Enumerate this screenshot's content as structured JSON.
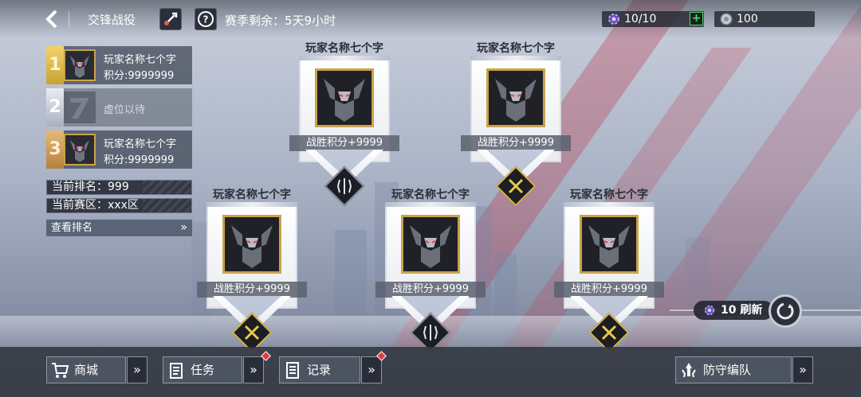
{
  "header": {
    "title": "交锋战役",
    "season_remaining": "赛季剩余：5天9小时"
  },
  "resources": {
    "energy": "10/10",
    "currency": "100",
    "plus_label": "+"
  },
  "ranking": {
    "items": [
      {
        "rank": "1",
        "name": "玩家名称七个字",
        "score": "积分:9999999"
      },
      {
        "rank": "2",
        "name": "",
        "score": "",
        "empty_label": "虚位以待"
      },
      {
        "rank": "3",
        "name": "玩家名称七个字",
        "score": "积分:9999999"
      }
    ],
    "current_rank": "当前排名：999",
    "current_zone": "当前赛区：xxx区",
    "view_rank": "查看排名",
    "view_rank_chevron": "»"
  },
  "opponents": [
    {
      "name": "玩家名称七个字",
      "reward": "战胜积分+9999",
      "badge": "shield-badge"
    },
    {
      "name": "玩家名称七个字",
      "reward": "战胜积分+9999",
      "badge": "swords-badge"
    },
    {
      "name": "玩家名称七个字",
      "reward": "战胜积分+9999",
      "badge": "swords-badge"
    },
    {
      "name": "玩家名称七个字",
      "reward": "战胜积分+9999",
      "badge": "shield-badge"
    },
    {
      "name": "玩家名称七个字",
      "reward": "战胜积分+9999",
      "badge": "swords-badge"
    }
  ],
  "refresh": {
    "label": "10 刷新"
  },
  "bottom_nav": {
    "shop": "商城",
    "tasks": "任务",
    "records": "记录",
    "defense": "防守编队",
    "chevron": "»"
  },
  "colors": {
    "gold": "#c9a34a",
    "accent_green": "#4fdc6b",
    "alert_red": "#e23a3a"
  }
}
